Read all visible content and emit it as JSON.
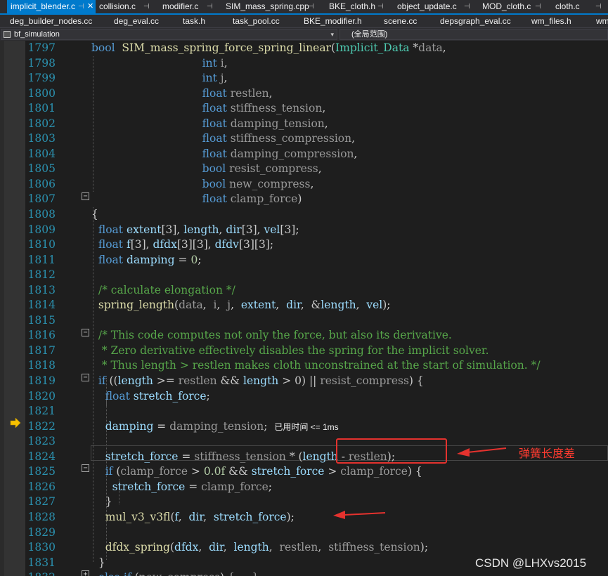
{
  "tabs_row1": [
    {
      "label": "implicit_blender.c",
      "pin": "⊣",
      "close": "✕",
      "active": true
    },
    {
      "label": "collision.c",
      "pin": "⊣"
    },
    {
      "label": "modifier.c",
      "pin": "⊣"
    },
    {
      "label": "SIM_mass_spring.cpp",
      "pin": "⊣"
    },
    {
      "label": "BKE_cloth.h",
      "pin": "⊣"
    },
    {
      "label": "object_update.c",
      "pin": "⊣"
    },
    {
      "label": "MOD_cloth.c",
      "pin": "⊣"
    },
    {
      "label": "cloth.c",
      "pin": "⊣"
    }
  ],
  "tabs_row2": [
    {
      "label": "deg_builder_nodes.cc"
    },
    {
      "label": "deg_eval.cc"
    },
    {
      "label": "task.h"
    },
    {
      "label": "task_pool.cc"
    },
    {
      "label": "BKE_modifier.h"
    },
    {
      "label": "scene.cc"
    },
    {
      "label": "depsgraph_eval.cc"
    },
    {
      "label": "wm_files.h"
    },
    {
      "label": "wm"
    }
  ],
  "navbar": {
    "project": "bf_simulation",
    "scope": "(全局范围)"
  },
  "editor": {
    "line_numbers": [
      "1797",
      "1798",
      "1799",
      "1800",
      "1801",
      "1802",
      "1803",
      "1804",
      "1805",
      "1806",
      "1807",
      "1808",
      "1809",
      "1810",
      "1811",
      "1812",
      "1813",
      "1814",
      "1815",
      "1816",
      "1817",
      "1818",
      "1819",
      "1820",
      "1821",
      "1822",
      "1823",
      "1824",
      "1825",
      "1826",
      "1827",
      "1828",
      "1829",
      "1830",
      "1831",
      "1832"
    ],
    "lines": [
      [
        [
          "kw",
          "bool"
        ],
        [
          "",
          "  "
        ],
        [
          "fn",
          "SIM_mass_spring_force_spring_linear"
        ],
        [
          "",
          "("
        ],
        [
          "ty",
          "Implicit_Data"
        ],
        [
          "",
          " *"
        ],
        [
          "pa",
          "data"
        ],
        [
          "",
          ","
        ]
      ],
      [
        [
          "",
          "                                "
        ],
        [
          "kw",
          "int"
        ],
        [
          "",
          " "
        ],
        [
          "pa",
          "i"
        ],
        [
          "",
          ","
        ]
      ],
      [
        [
          "",
          "                                "
        ],
        [
          "kw",
          "int"
        ],
        [
          "",
          " "
        ],
        [
          "pa",
          "j"
        ],
        [
          "",
          ","
        ]
      ],
      [
        [
          "",
          "                                "
        ],
        [
          "kw",
          "float"
        ],
        [
          "",
          " "
        ],
        [
          "pa",
          "restlen"
        ],
        [
          "",
          ","
        ]
      ],
      [
        [
          "",
          "                                "
        ],
        [
          "kw",
          "float"
        ],
        [
          "",
          " "
        ],
        [
          "pa",
          "stiffness_tension"
        ],
        [
          "",
          ","
        ]
      ],
      [
        [
          "",
          "                                "
        ],
        [
          "kw",
          "float"
        ],
        [
          "",
          " "
        ],
        [
          "pa",
          "damping_tension"
        ],
        [
          "",
          ","
        ]
      ],
      [
        [
          "",
          "                                "
        ],
        [
          "kw",
          "float"
        ],
        [
          "",
          " "
        ],
        [
          "pa",
          "stiffness_compression"
        ],
        [
          "",
          ","
        ]
      ],
      [
        [
          "",
          "                                "
        ],
        [
          "kw",
          "float"
        ],
        [
          "",
          " "
        ],
        [
          "pa",
          "damping_compression"
        ],
        [
          "",
          ","
        ]
      ],
      [
        [
          "",
          "                                "
        ],
        [
          "kw",
          "bool"
        ],
        [
          "",
          " "
        ],
        [
          "pa",
          "resist_compress"
        ],
        [
          "",
          ","
        ]
      ],
      [
        [
          "",
          "                                "
        ],
        [
          "kw",
          "bool"
        ],
        [
          "",
          " "
        ],
        [
          "pa",
          "new_compress"
        ],
        [
          "",
          ","
        ]
      ],
      [
        [
          "",
          "                                "
        ],
        [
          "kw",
          "float"
        ],
        [
          "",
          " "
        ],
        [
          "pa",
          "clamp_force"
        ],
        [
          "",
          ")"
        ]
      ],
      [
        [
          "",
          "{"
        ]
      ],
      [
        [
          "",
          "  "
        ],
        [
          "kw",
          "float"
        ],
        [
          "",
          " "
        ],
        [
          "va",
          "extent"
        ],
        [
          "",
          "[3], "
        ],
        [
          "va",
          "length"
        ],
        [
          "",
          ", "
        ],
        [
          "va",
          "dir"
        ],
        [
          "",
          "[3], "
        ],
        [
          "va",
          "vel"
        ],
        [
          "",
          "[3];"
        ]
      ],
      [
        [
          "",
          "  "
        ],
        [
          "kw",
          "float"
        ],
        [
          "",
          " "
        ],
        [
          "va",
          "f"
        ],
        [
          "",
          "[3], "
        ],
        [
          "va",
          "dfdx"
        ],
        [
          "",
          "[3][3], "
        ],
        [
          "va",
          "dfdv"
        ],
        [
          "",
          "[3][3];"
        ]
      ],
      [
        [
          "",
          "  "
        ],
        [
          "kw",
          "float"
        ],
        [
          "",
          " "
        ],
        [
          "va",
          "damping"
        ],
        [
          "",
          " = "
        ],
        [
          "nu",
          "0"
        ],
        [
          "",
          ";"
        ]
      ],
      [],
      [
        [
          "",
          "  "
        ],
        [
          "co",
          "/* calculate elongation */"
        ]
      ],
      [
        [
          "",
          "  "
        ],
        [
          "fn",
          "spring_length"
        ],
        [
          "",
          "("
        ],
        [
          "pa",
          "data"
        ],
        [
          "",
          ",  "
        ],
        [
          "pa",
          "i"
        ],
        [
          "",
          ",  "
        ],
        [
          "pa",
          "j"
        ],
        [
          "",
          ",  "
        ],
        [
          "va",
          "extent"
        ],
        [
          "",
          ",  "
        ],
        [
          "va",
          "dir"
        ],
        [
          "",
          ",  &"
        ],
        [
          "va",
          "length"
        ],
        [
          "",
          ",  "
        ],
        [
          "va",
          "vel"
        ],
        [
          "",
          ");"
        ]
      ],
      [],
      [
        [
          "",
          "  "
        ],
        [
          "co",
          "/* This code computes not only the force, but also its derivative."
        ]
      ],
      [
        [
          "",
          "   "
        ],
        [
          "co",
          "* Zero derivative effectively disables the spring for the implicit solver."
        ]
      ],
      [
        [
          "",
          "   "
        ],
        [
          "co",
          "* Thus length > restlen makes cloth unconstrained at the start of simulation. */"
        ]
      ],
      [
        [
          "",
          "  "
        ],
        [
          "kw",
          "if"
        ],
        [
          "",
          " (("
        ],
        [
          "va",
          "length"
        ],
        [
          "",
          " >= "
        ],
        [
          "pa",
          "restlen"
        ],
        [
          "",
          " && "
        ],
        [
          "va",
          "length"
        ],
        [
          "",
          " > 0) || "
        ],
        [
          "pa",
          "resist_compress"
        ],
        [
          "",
          ") {"
        ]
      ],
      [
        [
          "",
          "    "
        ],
        [
          "kw",
          "float"
        ],
        [
          "",
          " "
        ],
        [
          "va",
          "stretch_force"
        ],
        [
          "",
          ";"
        ]
      ],
      [],
      [
        [
          "",
          "    "
        ],
        [
          "va",
          "damping"
        ],
        [
          "",
          " = "
        ],
        [
          "pa",
          "damping_tension"
        ],
        [
          "",
          ";  "
        ],
        [
          "hint",
          "已用时间 <= 1ms"
        ]
      ],
      [],
      [
        [
          "",
          "    "
        ],
        [
          "va",
          "stretch_force"
        ],
        [
          "",
          " = "
        ],
        [
          "pa",
          "stiffness_tension"
        ],
        [
          "",
          " * ("
        ],
        [
          "va",
          "length"
        ],
        [
          "",
          " - "
        ],
        [
          "pa",
          "restlen"
        ],
        [
          "",
          ");"
        ]
      ],
      [
        [
          "",
          "    "
        ],
        [
          "kw",
          "if"
        ],
        [
          "",
          " ("
        ],
        [
          "pa",
          "clamp_force"
        ],
        [
          "",
          " > "
        ],
        [
          "nu",
          "0.0f"
        ],
        [
          "",
          " && "
        ],
        [
          "va",
          "stretch_force"
        ],
        [
          "",
          " > "
        ],
        [
          "pa",
          "clamp_force"
        ],
        [
          "",
          ") {"
        ]
      ],
      [
        [
          "",
          "      "
        ],
        [
          "va",
          "stretch_force"
        ],
        [
          "",
          " = "
        ],
        [
          "pa",
          "clamp_force"
        ],
        [
          "",
          ";"
        ]
      ],
      [
        [
          "",
          "    }"
        ]
      ],
      [
        [
          "",
          "    "
        ],
        [
          "fn",
          "mul_v3_v3fl"
        ],
        [
          "",
          "("
        ],
        [
          "va",
          "f"
        ],
        [
          "",
          ",  "
        ],
        [
          "va",
          "dir"
        ],
        [
          "",
          ",  "
        ],
        [
          "va",
          "stretch_force"
        ],
        [
          "",
          ");"
        ]
      ],
      [],
      [
        [
          "",
          "    "
        ],
        [
          "fn",
          "dfdx_spring"
        ],
        [
          "",
          "("
        ],
        [
          "va",
          "dfdx"
        ],
        [
          "",
          ",  "
        ],
        [
          "va",
          "dir"
        ],
        [
          "",
          ",  "
        ],
        [
          "va",
          "length"
        ],
        [
          "",
          ",  "
        ],
        [
          "pa",
          "restlen"
        ],
        [
          "",
          ",  "
        ],
        [
          "pa",
          "stiffness_tension"
        ],
        [
          "",
          ");"
        ]
      ],
      [
        [
          "",
          "  }"
        ]
      ],
      [
        [
          "",
          "  "
        ],
        [
          "kw",
          "else if"
        ],
        [
          "",
          " ("
        ],
        [
          "pa",
          "new_compress"
        ],
        [
          "",
          ") "
        ],
        [
          "pa",
          "{ ... }"
        ]
      ]
    ]
  },
  "annotation": {
    "label": "弹簧长度差"
  },
  "watermark": "CSDN @LHXvs2015",
  "colors": {
    "accent": "#007acc",
    "annotation": "#e5322e"
  },
  "icons": [
    "pin-icon",
    "close-icon",
    "project-icon",
    "dropdown-chevron-icon",
    "execution-pointer-icon",
    "fold-icon"
  ]
}
